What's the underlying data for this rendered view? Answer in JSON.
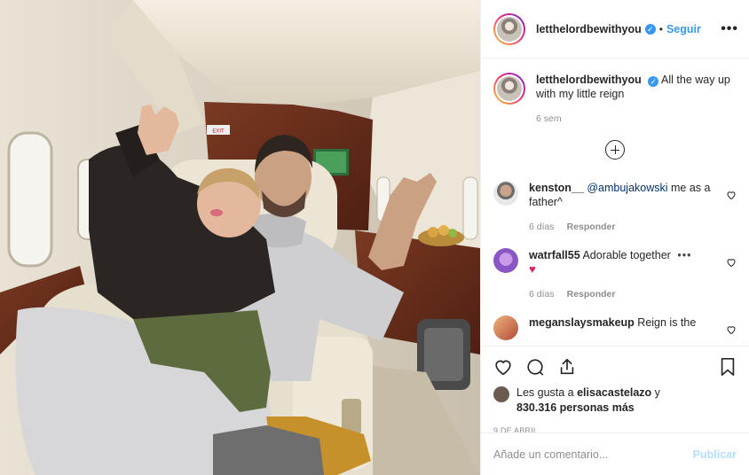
{
  "post": {
    "username": "letthelordbewithyou",
    "follow_label": "Seguir",
    "separator": "•",
    "caption": "All the way up with my little reign",
    "caption_time": "6 sem",
    "verified_mark": "✓"
  },
  "comments": [
    {
      "username": "kenston__",
      "mention": "@ambujakowski",
      "text": " me as a father^",
      "time": "6 días",
      "reply": "Responder",
      "avatar_color": "#c8c8c8"
    },
    {
      "username": "watrfall55",
      "mention": "",
      "text": "Adorable together",
      "emoji": "♥",
      "time": "6 días",
      "reply": "Responder",
      "avatar_color": "#9a6bd6"
    },
    {
      "username": "meganslaysmakeup",
      "mention": "",
      "text": "Reign is the",
      "time": "",
      "reply": "",
      "avatar_color": "#e08a5c"
    }
  ],
  "likes": {
    "prefix": "Les gusta a ",
    "user": "elisacastelazo",
    "suffix": " y",
    "count": "830.316 personas más"
  },
  "date": "9 DE ABRIL",
  "add_comment": {
    "placeholder": "Añade un comentario...",
    "publish": "Publicar"
  },
  "photo": {
    "exit_sign": "EXIT"
  },
  "colors": {
    "link": "#3897f0",
    "verified": "#3897f0",
    "muted": "#8e8e8e"
  },
  "icons": {
    "more": "more-options-icon",
    "heart": "heart-icon",
    "comment": "comment-icon",
    "share": "share-icon",
    "bookmark": "bookmark-icon",
    "plus": "load-more-icon"
  }
}
